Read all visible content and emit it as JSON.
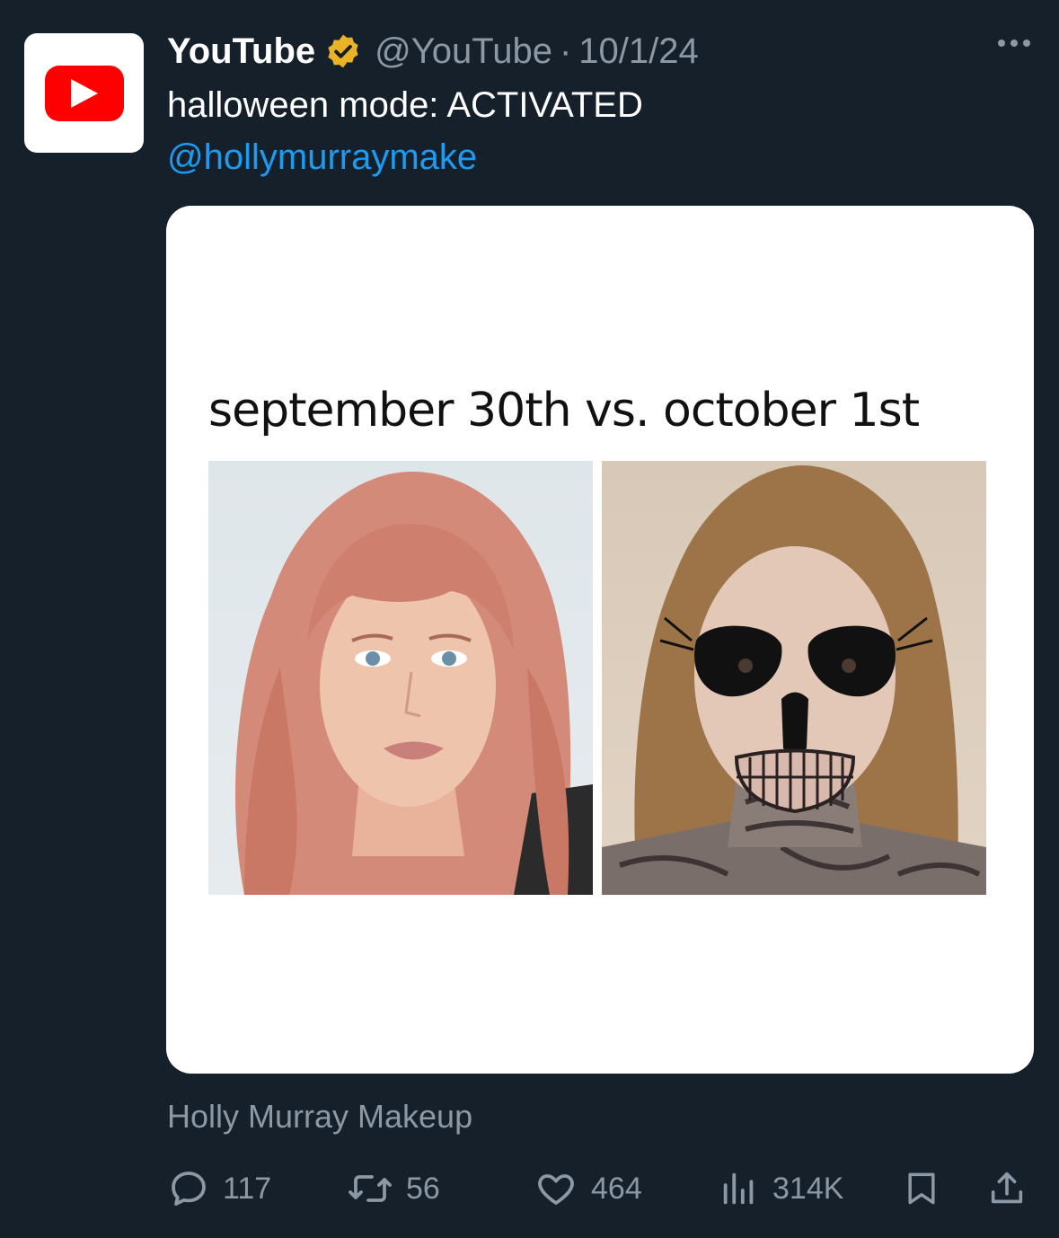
{
  "author": {
    "display_name": "YouTube",
    "handle": "@YouTube",
    "separator": "·",
    "date": "10/1/24",
    "avatar_icon": "youtube-logo-icon",
    "verified_icon": "verified-badge-icon"
  },
  "tweet": {
    "text": "halloween mode: ACTIVATED",
    "mention": "@hollymurraymake"
  },
  "media": {
    "caption": "september 30th vs. october 1st"
  },
  "source_label": "Holly Murray Makeup",
  "actions": {
    "replies": "117",
    "reposts": "56",
    "likes": "464",
    "views": "314K"
  },
  "colors": {
    "background": "#15202b",
    "link": "#1d9bf0",
    "muted": "#8b98a5",
    "verified": "#e8b326",
    "youtube_red": "#ff0000"
  }
}
